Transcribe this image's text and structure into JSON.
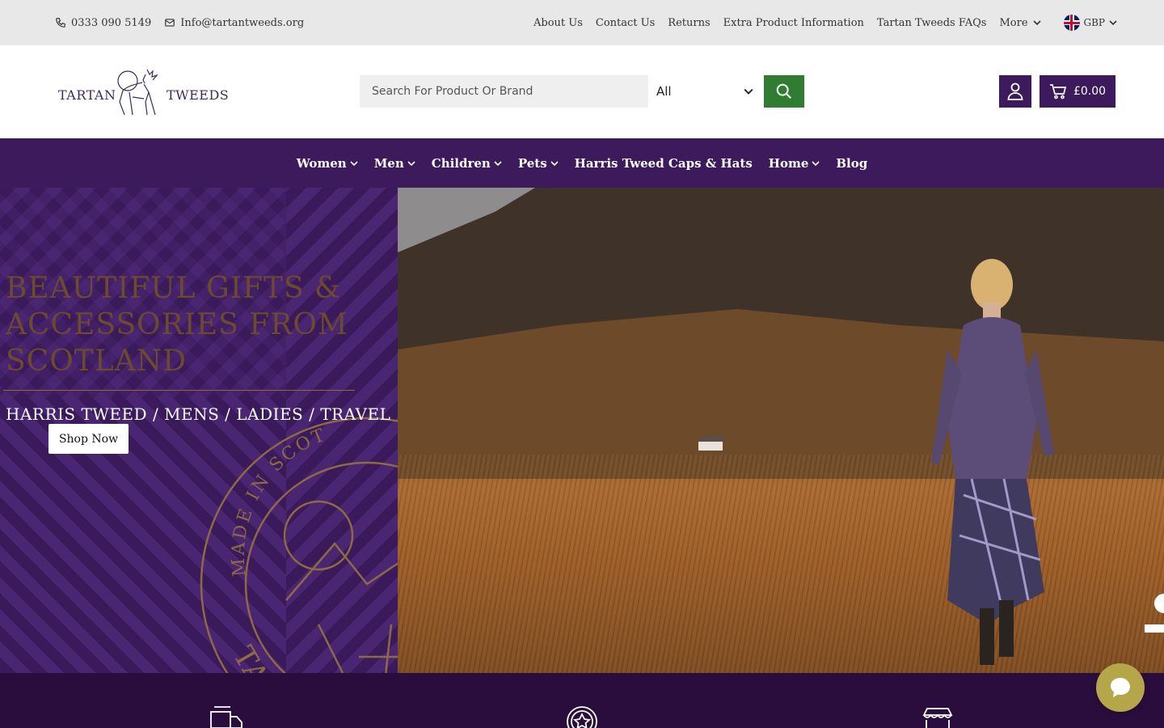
{
  "topbar": {
    "phone": "0333 090 5149",
    "email": "Info@tartantweeds.org",
    "links": [
      "About Us",
      "Contact Us",
      "Returns",
      "Extra Product Information",
      "Tartan Tweeds FAQs"
    ],
    "more_label": "More",
    "currency": "GBP"
  },
  "header": {
    "logo_word_left": "TARTAN",
    "logo_word_right": "TWEEDS",
    "search_placeholder": "Search For Product Or Brand",
    "category_selected": "All",
    "cart_total": "£0.00"
  },
  "nav": {
    "items": [
      {
        "label": "Women",
        "dropdown": true
      },
      {
        "label": "Men",
        "dropdown": true
      },
      {
        "label": "Children",
        "dropdown": true
      },
      {
        "label": "Pets",
        "dropdown": true
      },
      {
        "label": "Harris Tweed Caps & Hats",
        "dropdown": false
      },
      {
        "label": "Home",
        "dropdown": true
      },
      {
        "label": "Blog",
        "dropdown": false
      }
    ]
  },
  "hero": {
    "title_lines": [
      "BEAUTIFUL GIFTS &",
      "ACCESSORIES FROM",
      "SCOTLAND"
    ],
    "subtitle": "HARRIS TWEED / MENS / LADIES / TRAVEL",
    "cta_label": "Shop Now",
    "seal_text": "MADE IN SCOT",
    "seal_bottom_text": "TA"
  },
  "colors": {
    "brand_purple": "#3d1a5b",
    "search_green": "#2e7d32",
    "hero_gold": "#6b4a2e",
    "features_bg": "#2a0d3d",
    "chat_bubble": "#b5a64a"
  },
  "icons": {
    "phone": "phone-icon",
    "email": "mail-icon",
    "search": "search-icon",
    "account": "user-icon",
    "cart": "cart-icon",
    "chat": "chat-bubble-icon",
    "features": [
      "delivery-truck-icon",
      "star-badge-icon",
      "store-front-icon"
    ]
  }
}
